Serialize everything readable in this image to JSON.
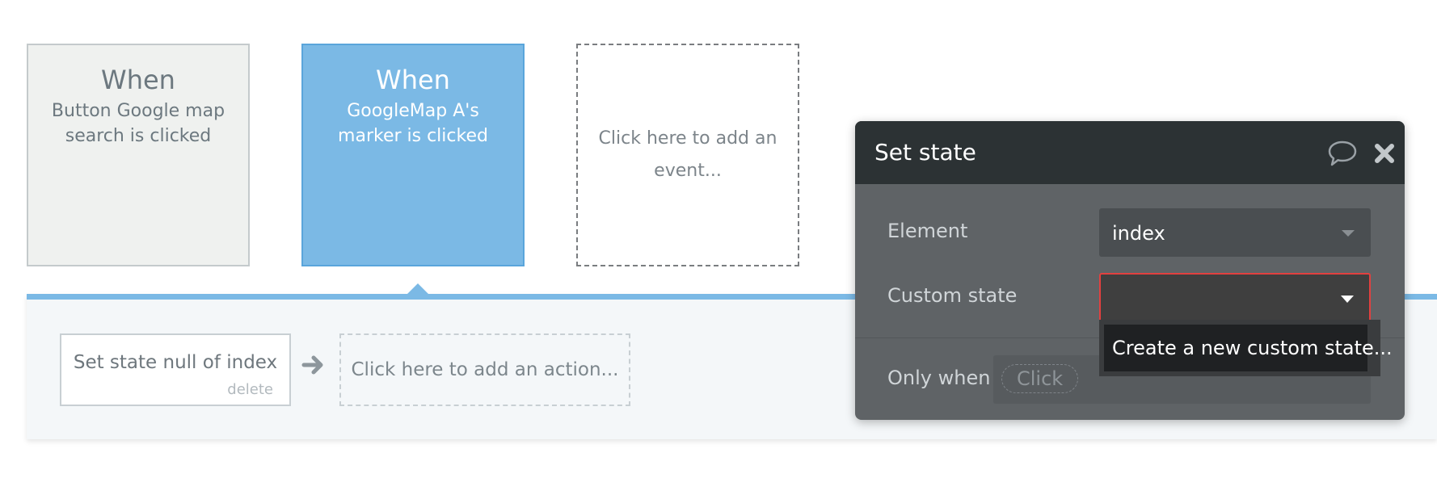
{
  "events": [
    {
      "title": "When",
      "description": "Button Google map search is clicked"
    },
    {
      "title": "When",
      "description": "GoogleMap A's marker is clicked"
    },
    {
      "description": "Click here to add an event..."
    }
  ],
  "actions": {
    "items": [
      {
        "label": "Set state null of index",
        "delete_label": "delete"
      }
    ],
    "add_placeholder": "Click here to add an action..."
  },
  "panel": {
    "title": "Set state",
    "element_label": "Element",
    "element_value": "index",
    "custom_state_label": "Custom state",
    "custom_state_value": "",
    "only_when_label": "Only when",
    "only_when_chip": "Click"
  },
  "dropdown": {
    "options": [
      "Create a new custom state..."
    ]
  },
  "colors": {
    "selected_event": "#7bb9e5",
    "panel_header": "#2c3234",
    "panel_body": "#5f6366",
    "error_border": "#e2403f"
  },
  "icons": {
    "comment": "comment-icon",
    "close": "close-icon",
    "arrow": "arrow-right-icon"
  }
}
